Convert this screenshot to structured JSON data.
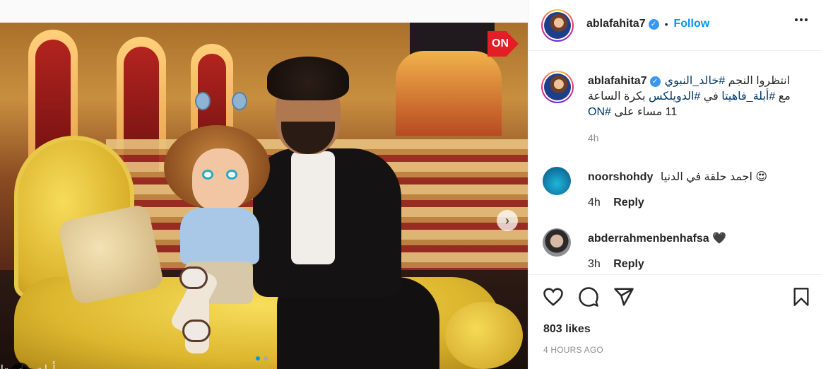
{
  "post": {
    "username": "ablafahita7",
    "follow_label": "Follow",
    "separator": "•",
    "verified_mark": "✓",
    "caption_line1_prefix": "انتظروا النجم ",
    "caption_hashtag1": "#خالد_النبوي",
    "caption_line2_prefix": "مع ",
    "caption_hashtag2": "#أبلة_فاهيتا",
    "caption_line2_mid": " في ",
    "caption_hashtag3": "#الدويلكس",
    "caption_line2_suffix": " بكرة الساعة",
    "caption_line3_text": "11 مساء على ",
    "caption_hashtag4": "#ON",
    "caption_age": "4h",
    "likes": "803 likes",
    "posted": "4 HOURS AGO"
  },
  "comments": [
    {
      "username": "noorshohdy",
      "text": "اجمد حلقة في الدنيا",
      "emoji": "😍",
      "age": "4h",
      "reply_label": "Reply"
    },
    {
      "username": "abderrahmenbenhafsa",
      "emoji": "🖤",
      "age": "3h",
      "reply_label": "Reply"
    }
  ],
  "media": {
    "channel_logo": "ON",
    "watermark": "أبلة فاهيتا",
    "carousel_dots": 2,
    "active_dot": 0
  },
  "icons": {
    "like": "heart-icon",
    "comment": "comment-icon",
    "share": "share-icon",
    "save": "bookmark-icon",
    "more": "more-options-icon",
    "next": "chevron-right-icon",
    "tags": "user-tag-icon"
  },
  "colors": {
    "link": "#0095f6",
    "hashtag": "#00376b",
    "meta": "#8e8e8e",
    "verified": "#3897f0"
  }
}
